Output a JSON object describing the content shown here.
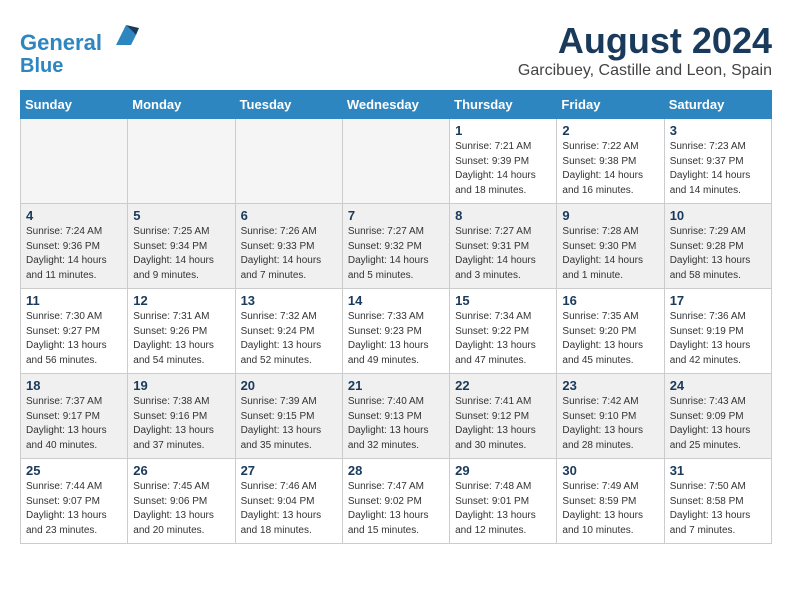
{
  "header": {
    "logo_line1": "General",
    "logo_line2": "Blue",
    "month": "August 2024",
    "location": "Garcibuey, Castille and Leon, Spain"
  },
  "weekdays": [
    "Sunday",
    "Monday",
    "Tuesday",
    "Wednesday",
    "Thursday",
    "Friday",
    "Saturday"
  ],
  "weeks": [
    [
      {
        "day": "",
        "empty": true
      },
      {
        "day": "",
        "empty": true
      },
      {
        "day": "",
        "empty": true
      },
      {
        "day": "",
        "empty": true
      },
      {
        "day": "1",
        "info": "Sunrise: 7:21 AM\nSunset: 9:39 PM\nDaylight: 14 hours\nand 18 minutes."
      },
      {
        "day": "2",
        "info": "Sunrise: 7:22 AM\nSunset: 9:38 PM\nDaylight: 14 hours\nand 16 minutes."
      },
      {
        "day": "3",
        "info": "Sunrise: 7:23 AM\nSunset: 9:37 PM\nDaylight: 14 hours\nand 14 minutes."
      }
    ],
    [
      {
        "day": "4",
        "info": "Sunrise: 7:24 AM\nSunset: 9:36 PM\nDaylight: 14 hours\nand 11 minutes."
      },
      {
        "day": "5",
        "info": "Sunrise: 7:25 AM\nSunset: 9:34 PM\nDaylight: 14 hours\nand 9 minutes."
      },
      {
        "day": "6",
        "info": "Sunrise: 7:26 AM\nSunset: 9:33 PM\nDaylight: 14 hours\nand 7 minutes."
      },
      {
        "day": "7",
        "info": "Sunrise: 7:27 AM\nSunset: 9:32 PM\nDaylight: 14 hours\nand 5 minutes."
      },
      {
        "day": "8",
        "info": "Sunrise: 7:27 AM\nSunset: 9:31 PM\nDaylight: 14 hours\nand 3 minutes."
      },
      {
        "day": "9",
        "info": "Sunrise: 7:28 AM\nSunset: 9:30 PM\nDaylight: 14 hours\nand 1 minute."
      },
      {
        "day": "10",
        "info": "Sunrise: 7:29 AM\nSunset: 9:28 PM\nDaylight: 13 hours\nand 58 minutes."
      }
    ],
    [
      {
        "day": "11",
        "info": "Sunrise: 7:30 AM\nSunset: 9:27 PM\nDaylight: 13 hours\nand 56 minutes."
      },
      {
        "day": "12",
        "info": "Sunrise: 7:31 AM\nSunset: 9:26 PM\nDaylight: 13 hours\nand 54 minutes."
      },
      {
        "day": "13",
        "info": "Sunrise: 7:32 AM\nSunset: 9:24 PM\nDaylight: 13 hours\nand 52 minutes."
      },
      {
        "day": "14",
        "info": "Sunrise: 7:33 AM\nSunset: 9:23 PM\nDaylight: 13 hours\nand 49 minutes."
      },
      {
        "day": "15",
        "info": "Sunrise: 7:34 AM\nSunset: 9:22 PM\nDaylight: 13 hours\nand 47 minutes."
      },
      {
        "day": "16",
        "info": "Sunrise: 7:35 AM\nSunset: 9:20 PM\nDaylight: 13 hours\nand 45 minutes."
      },
      {
        "day": "17",
        "info": "Sunrise: 7:36 AM\nSunset: 9:19 PM\nDaylight: 13 hours\nand 42 minutes."
      }
    ],
    [
      {
        "day": "18",
        "info": "Sunrise: 7:37 AM\nSunset: 9:17 PM\nDaylight: 13 hours\nand 40 minutes."
      },
      {
        "day": "19",
        "info": "Sunrise: 7:38 AM\nSunset: 9:16 PM\nDaylight: 13 hours\nand 37 minutes."
      },
      {
        "day": "20",
        "info": "Sunrise: 7:39 AM\nSunset: 9:15 PM\nDaylight: 13 hours\nand 35 minutes."
      },
      {
        "day": "21",
        "info": "Sunrise: 7:40 AM\nSunset: 9:13 PM\nDaylight: 13 hours\nand 32 minutes."
      },
      {
        "day": "22",
        "info": "Sunrise: 7:41 AM\nSunset: 9:12 PM\nDaylight: 13 hours\nand 30 minutes."
      },
      {
        "day": "23",
        "info": "Sunrise: 7:42 AM\nSunset: 9:10 PM\nDaylight: 13 hours\nand 28 minutes."
      },
      {
        "day": "24",
        "info": "Sunrise: 7:43 AM\nSunset: 9:09 PM\nDaylight: 13 hours\nand 25 minutes."
      }
    ],
    [
      {
        "day": "25",
        "info": "Sunrise: 7:44 AM\nSunset: 9:07 PM\nDaylight: 13 hours\nand 23 minutes."
      },
      {
        "day": "26",
        "info": "Sunrise: 7:45 AM\nSunset: 9:06 PM\nDaylight: 13 hours\nand 20 minutes."
      },
      {
        "day": "27",
        "info": "Sunrise: 7:46 AM\nSunset: 9:04 PM\nDaylight: 13 hours\nand 18 minutes."
      },
      {
        "day": "28",
        "info": "Sunrise: 7:47 AM\nSunset: 9:02 PM\nDaylight: 13 hours\nand 15 minutes."
      },
      {
        "day": "29",
        "info": "Sunrise: 7:48 AM\nSunset: 9:01 PM\nDaylight: 13 hours\nand 12 minutes."
      },
      {
        "day": "30",
        "info": "Sunrise: 7:49 AM\nSunset: 8:59 PM\nDaylight: 13 hours\nand 10 minutes."
      },
      {
        "day": "31",
        "info": "Sunrise: 7:50 AM\nSunset: 8:58 PM\nDaylight: 13 hours\nand 7 minutes."
      }
    ]
  ]
}
